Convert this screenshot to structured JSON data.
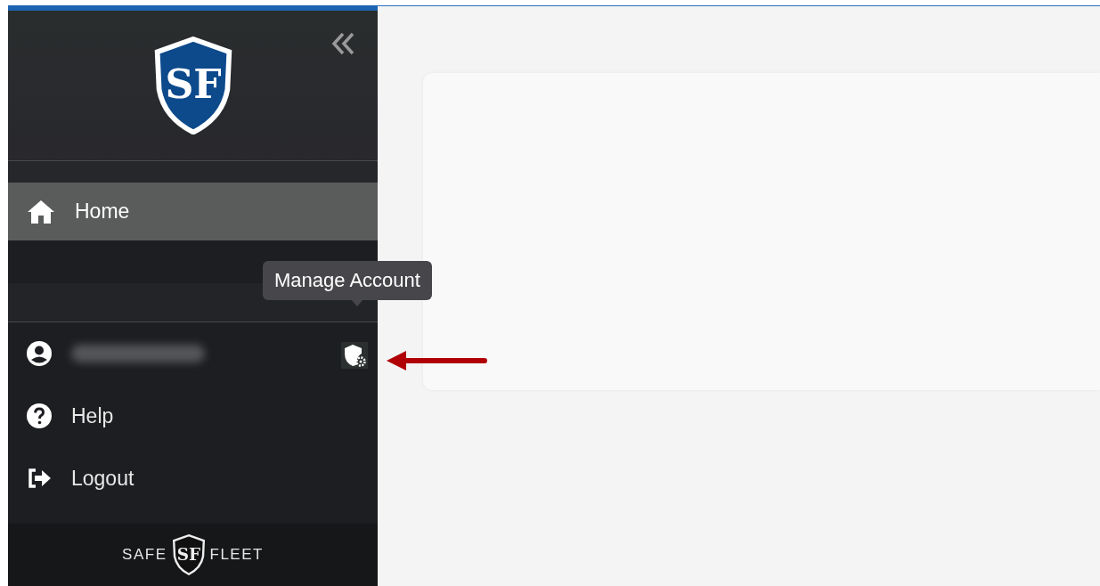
{
  "sidebar": {
    "logo_text": "SF",
    "nav_items": [
      {
        "kind": "home",
        "label": "Home",
        "selected": true
      }
    ],
    "account": {
      "tooltip": "Manage Account"
    },
    "bottom_items": [
      {
        "kind": "help",
        "label": "Help",
        "selected": false
      },
      {
        "kind": "logout",
        "label": "Logout",
        "selected": false
      }
    ],
    "brand": {
      "left": "SAFE",
      "mark": "SF",
      "right": "FLEET"
    }
  }
}
